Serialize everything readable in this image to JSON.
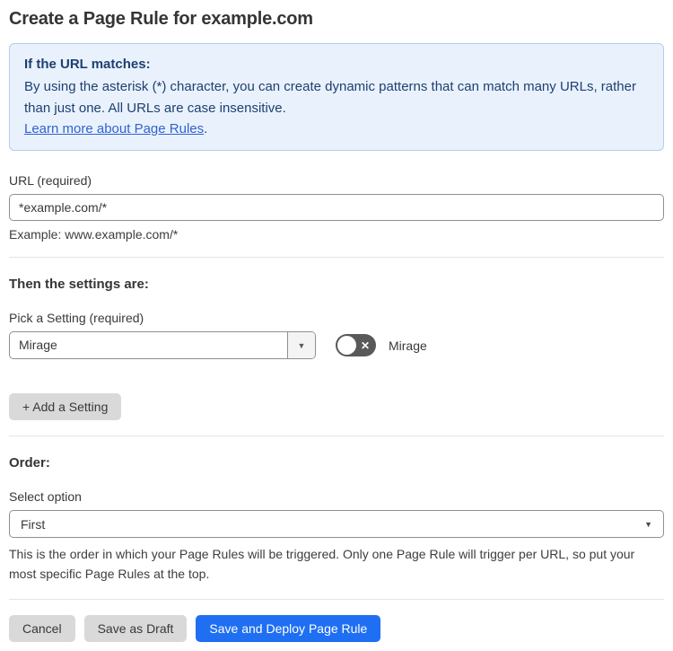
{
  "page": {
    "title": "Create a Page Rule for example.com"
  },
  "info_box": {
    "heading": "If the URL matches:",
    "body": "By using the asterisk (*) character, you can create dynamic patterns that can match many URLs, rather than just one. All URLs are case insensitive.",
    "link_label": "Learn more about Page Rules",
    "link_suffix": "."
  },
  "url_field": {
    "label": "URL (required)",
    "value": "*example.com/*",
    "helper": "Example: www.example.com/*"
  },
  "settings_section": {
    "heading": "Then the settings are:",
    "setting_label": "Pick a Setting (required)",
    "setting_value": "Mirage",
    "toggle": {
      "state": "off",
      "label": "Mirage"
    },
    "add_setting_label": "+ Add a Setting"
  },
  "order_section": {
    "heading": "Order:",
    "select_label": "Select option",
    "select_value": "First",
    "helper": "This is the order in which your Page Rules will be triggered. Only one Page Rule will trigger per URL, so put your most specific Page Rules at the top."
  },
  "footer": {
    "cancel_label": "Cancel",
    "save_draft_label": "Save as Draft",
    "save_deploy_label": "Save and Deploy Page Rule"
  },
  "icons": {
    "dropdown_arrow": "▼",
    "toggle_x": "✕"
  },
  "colors": {
    "primary_blue": "#1f6ff2",
    "info_background": "#e9f2fc",
    "info_border": "#aecff0",
    "info_text": "#1e3f72",
    "link_blue": "#3262d1",
    "toggle_off_background": "#595959",
    "gray_button": "#d9d9d9",
    "text_dark": "#36393a"
  }
}
